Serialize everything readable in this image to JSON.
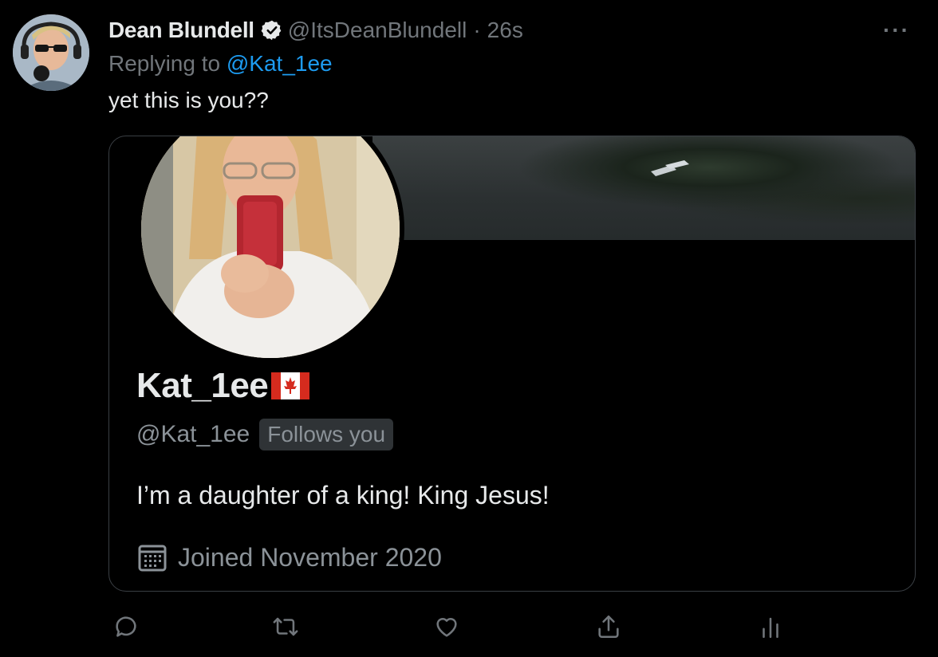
{
  "author": {
    "display_name": "Dean Blundell",
    "handle": "@ItsDeanBlundell",
    "separator": "·",
    "time": "26s",
    "verified": true
  },
  "more_icon": "more-horizontal-icon",
  "more_label": "···",
  "reply": {
    "prefix": "Replying to",
    "target": "@Kat_1ee"
  },
  "tweet_text": "yet this is you??",
  "embedded_profile": {
    "name": "Kat_1ee",
    "flag": "canada-flag-icon",
    "handle": "@Kat_1ee",
    "badge": "Follows you",
    "bio": "I’m a daughter of a king! King Jesus!",
    "joined": "Joined November 2020",
    "joined_icon": "calendar-icon"
  },
  "actions": [
    {
      "name": "reply",
      "icon": "reply-icon"
    },
    {
      "name": "retweet",
      "icon": "retweet-icon"
    },
    {
      "name": "like",
      "icon": "like-icon"
    },
    {
      "name": "share",
      "icon": "share-icon"
    },
    {
      "name": "analytics",
      "icon": "analytics-icon"
    }
  ],
  "colors": {
    "background": "#000000",
    "text": "#e7e9ea",
    "muted": "#71767b",
    "link": "#1d9bf0",
    "border": "#3a3f44"
  }
}
